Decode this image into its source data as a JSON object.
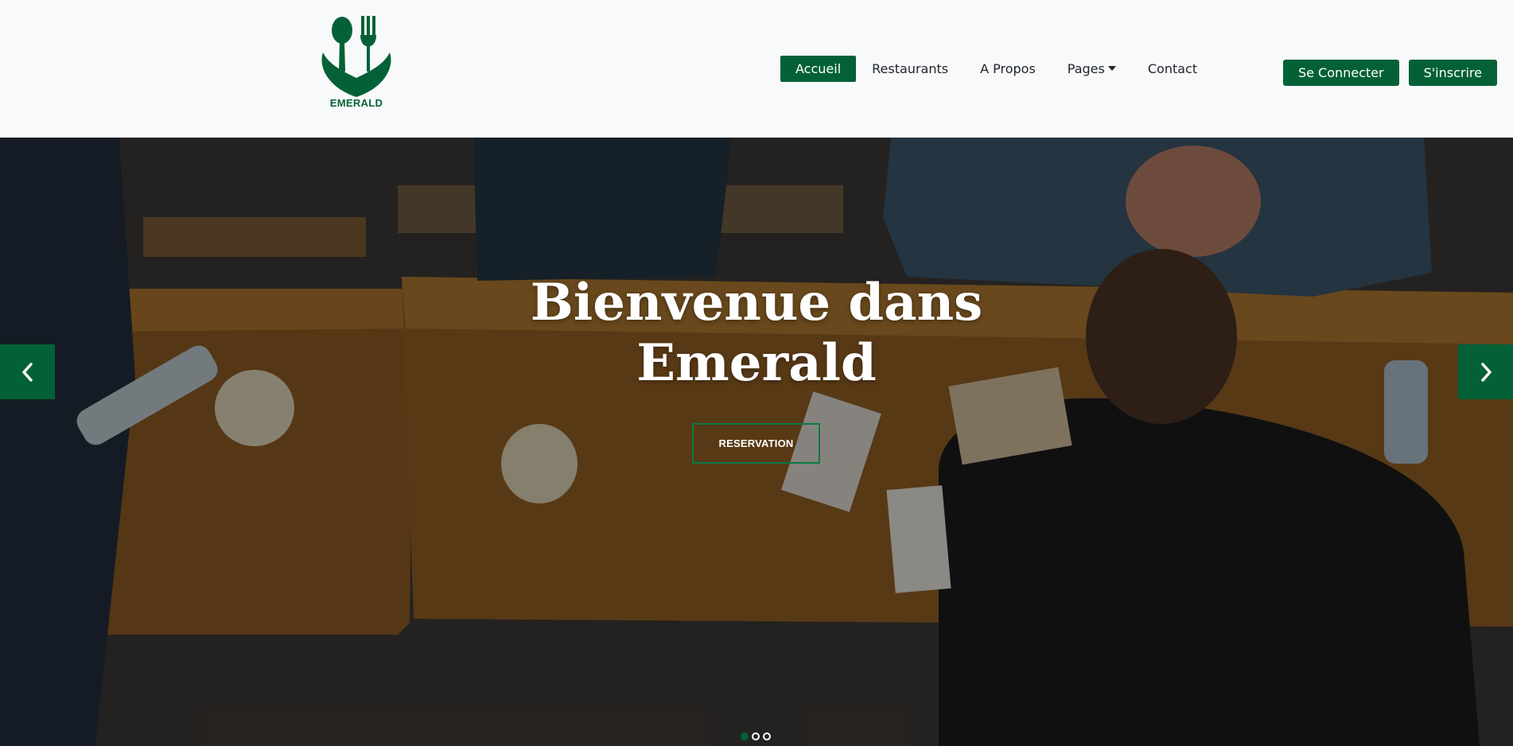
{
  "brand": {
    "name": "EMERALD",
    "color": "#046137"
  },
  "nav": {
    "items": [
      {
        "label": "Accueil",
        "active": true
      },
      {
        "label": "Restaurants",
        "active": false
      },
      {
        "label": "A Propos",
        "active": false
      },
      {
        "label": "Pages",
        "active": false,
        "dropdown": true
      },
      {
        "label": "Contact",
        "active": false
      }
    ]
  },
  "auth": {
    "login_label": "Se Connecter",
    "signup_label": "S'inscrire"
  },
  "hero": {
    "title_line1": "Bienvenue dans",
    "title_line2": "Emerald",
    "button_label": "RESERVATION",
    "prev_icon": "chevron-left-icon",
    "next_icon": "chevron-right-icon",
    "slide_count": 3,
    "active_slide": 1
  }
}
